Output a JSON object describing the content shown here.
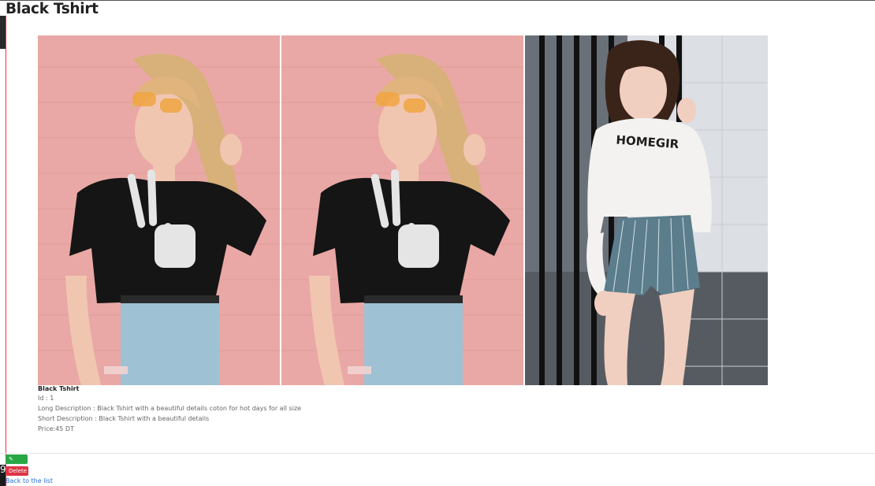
{
  "page": {
    "title": "Black Tshirt",
    "page_number": "9"
  },
  "gallery": {
    "images": [
      {
        "name": "model-black-tshirt-1"
      },
      {
        "name": "model-black-tshirt-2"
      },
      {
        "name": "model-white-sweater",
        "print_text": "HOMEGIR"
      }
    ]
  },
  "product": {
    "name": "Black Tshirt",
    "id_line": "Id : 1",
    "long_description": "Long Description : Black Tshirt with a beautiful details coton for hot days for all size",
    "short_description": "Short Description : Black Tshirt with a beautiful details",
    "price_line": "Price:45 DT"
  },
  "actions": {
    "edit_label": "✎ Edit",
    "delete_label": "Delete",
    "back_label": "Back to the list"
  },
  "colors": {
    "accent_red": "#e8334a",
    "edit_green": "#28a745",
    "delete_red": "#dc3545",
    "link_blue": "#2a6fd6"
  }
}
